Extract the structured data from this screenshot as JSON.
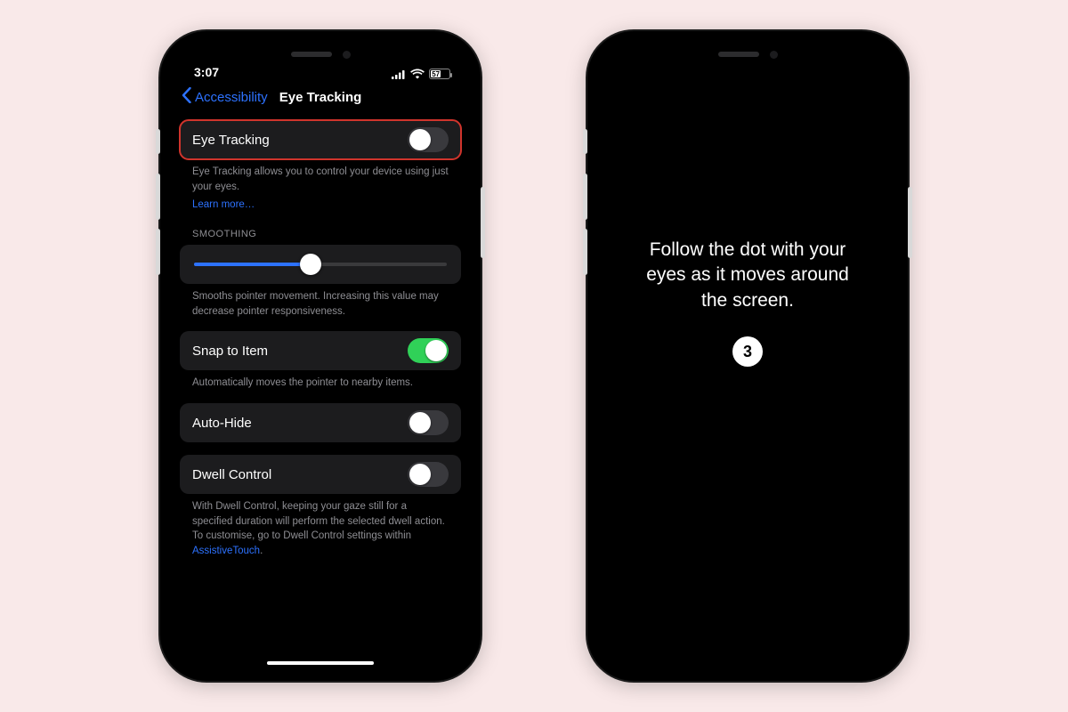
{
  "status": {
    "time": "3:07",
    "battery_pct": 57
  },
  "nav": {
    "back_label": "Accessibility",
    "title": "Eye Tracking"
  },
  "toggles": {
    "eye_tracking": {
      "label": "Eye Tracking",
      "on": false,
      "caption": "Eye Tracking allows you to control your device using just your eyes.",
      "learn_more": "Learn more…"
    },
    "smoothing": {
      "section": "SMOOTHING",
      "value_pct": 46,
      "caption": "Smooths pointer movement. Increasing this value may decrease pointer responsiveness."
    },
    "snap": {
      "label": "Snap to Item",
      "on": true,
      "caption": "Automatically moves the pointer to nearby items."
    },
    "auto_hide": {
      "label": "Auto-Hide",
      "on": false
    },
    "dwell": {
      "label": "Dwell Control",
      "on": false,
      "caption_pre": "With Dwell Control, keeping your gaze still for a specified duration will perform the selected dwell action. To customise, go to Dwell Control settings within ",
      "caption_link": "AssistiveTouch",
      "caption_post": "."
    }
  },
  "calibration": {
    "message": "Follow the dot with your eyes as it moves around the screen.",
    "count": "3"
  }
}
